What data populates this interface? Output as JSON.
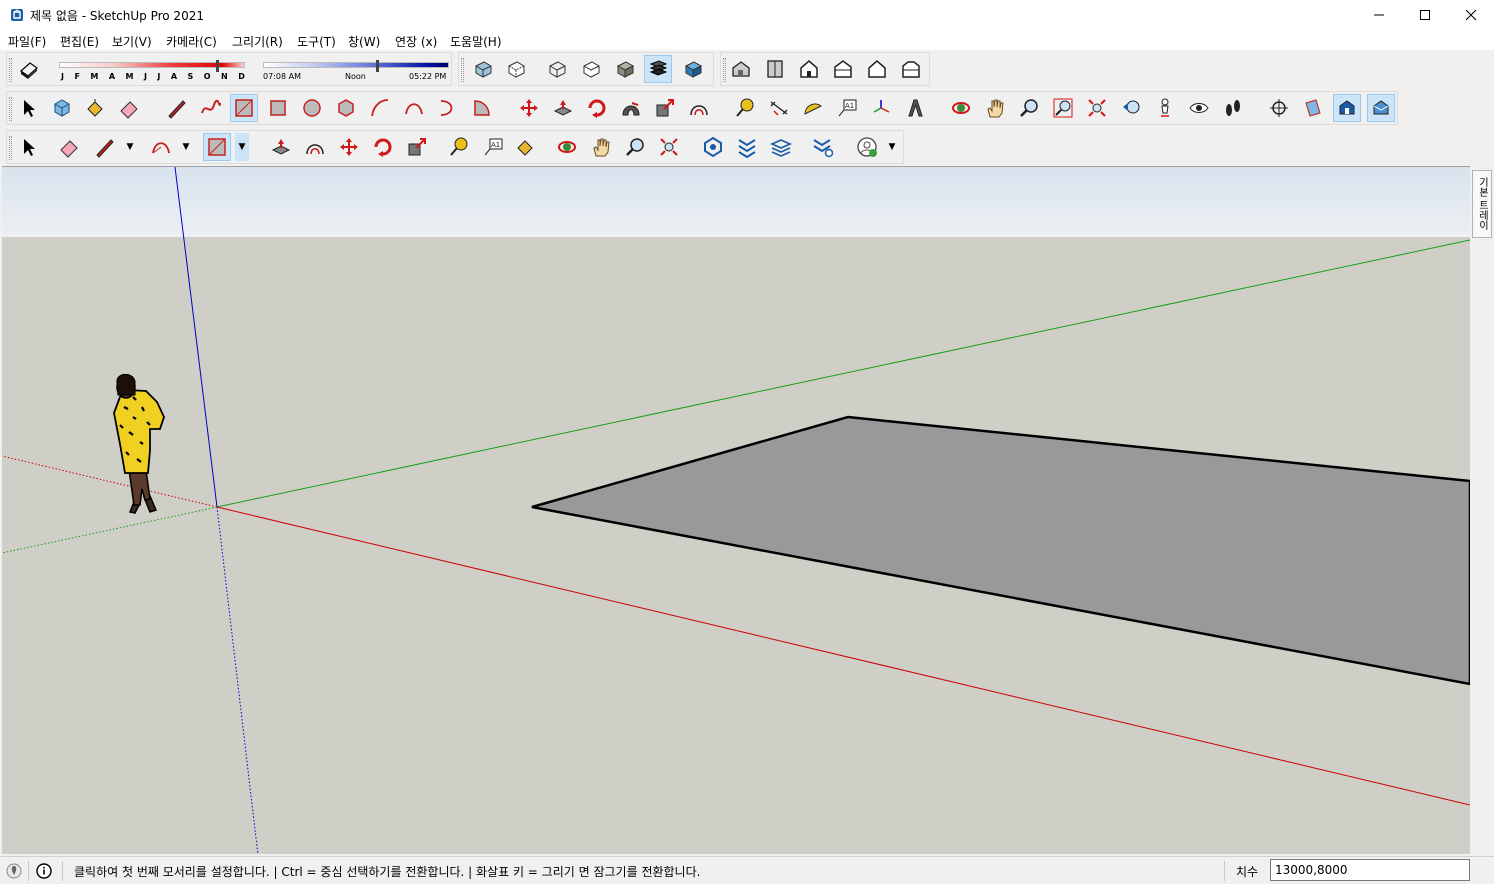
{
  "window": {
    "title": "제목 없음 - SketchUp Pro 2021",
    "app_icon": "sketchup-logo-icon",
    "controls": [
      "minimize-icon",
      "maximize-icon",
      "close-icon"
    ]
  },
  "menu": {
    "items": [
      {
        "label": "파일(F)"
      },
      {
        "label": "편집(E)"
      },
      {
        "label": "보기(V)"
      },
      {
        "label": "카메라(C)"
      },
      {
        "label": "그리기(R)"
      },
      {
        "label": "도구(T)"
      },
      {
        "label": "창(W)"
      },
      {
        "label": "연장 (x)"
      },
      {
        "label": "도움말(H)"
      }
    ]
  },
  "shadows": {
    "months": [
      "J",
      "F",
      "M",
      "A",
      "M",
      "J",
      "J",
      "A",
      "S",
      "O",
      "N",
      "D"
    ],
    "month_position": 0.86,
    "time_start": "07:08 AM",
    "time_mid": "Noon",
    "time_end": "05:22 PM",
    "time_position": 0.62
  },
  "toolbar": {
    "row1": {
      "styles": [
        "xray-icon",
        "back-edges-icon",
        "wireframe-icon",
        "hidden-line-icon",
        "shaded-icon",
        "shaded-textures-icon",
        "monochrome-icon"
      ],
      "active_style": "shaded-textures-icon",
      "views": [
        "iso-view-icon",
        "top-view-icon",
        "front-view-icon",
        "right-view-icon",
        "back-view-icon",
        "left-view-icon"
      ]
    },
    "row2": {
      "tools": [
        "select-icon",
        "make-component-icon",
        "paint-bucket-icon",
        "eraser-icon",
        "line-icon",
        "freehand-icon",
        "rectangle-icon",
        "rotated-rectangle-icon",
        "circle-icon",
        "polygon-icon",
        "arc-icon",
        "two-point-arc-icon",
        "three-point-arc-icon",
        "pie-icon",
        "move-icon",
        "push-pull-icon",
        "rotate-icon",
        "follow-me-icon",
        "scale-icon",
        "offset-icon",
        "tape-measure-icon",
        "dimension-icon",
        "protractor-icon",
        "text-icon",
        "axes-icon",
        "3d-text-icon",
        "orbit-icon",
        "pan-icon",
        "zoom-icon",
        "zoom-window-icon",
        "zoom-extents-icon",
        "previous-view-icon",
        "position-camera-icon",
        "look-around-icon",
        "walk-icon",
        "section-plane-icon",
        "display-section-planes-icon",
        "display-section-cuts-icon",
        "display-section-fill-icon"
      ]
    },
    "row3": {
      "tools": [
        "select-icon",
        "eraser-icon",
        "pencil-icon",
        "arc-icon",
        "rectangle-icon",
        "push-pull-icon",
        "offset-icon",
        "move-icon",
        "rotate-icon",
        "scale-icon",
        "tape-measure-icon",
        "text-icon",
        "paint-bucket-icon",
        "orbit-icon",
        "pan-icon",
        "zoom-icon",
        "zoom-extents-icon",
        "3d-warehouse-icon",
        "extension-warehouse-icon",
        "layout-icon",
        "extension-manager-icon",
        "account-icon"
      ]
    }
  },
  "tray": {
    "label": "기본 트레이"
  },
  "status": {
    "message": "클릭하여 첫 번째 모서리를 설정합니다. | Ctrl = 중심 선택하기를 전환합니다. | 화살표 키 = 그리기 면 잠그기를 전환합니다.",
    "measure_label": "치수",
    "measure_value": "13000,8000"
  },
  "colors": {
    "red_axis": "#cc0000",
    "green_axis": "#1a9e1a",
    "blue_axis": "#0000cc",
    "ground": "#cfcfc8",
    "face": "#999999",
    "sky": "#dfe7ef"
  }
}
